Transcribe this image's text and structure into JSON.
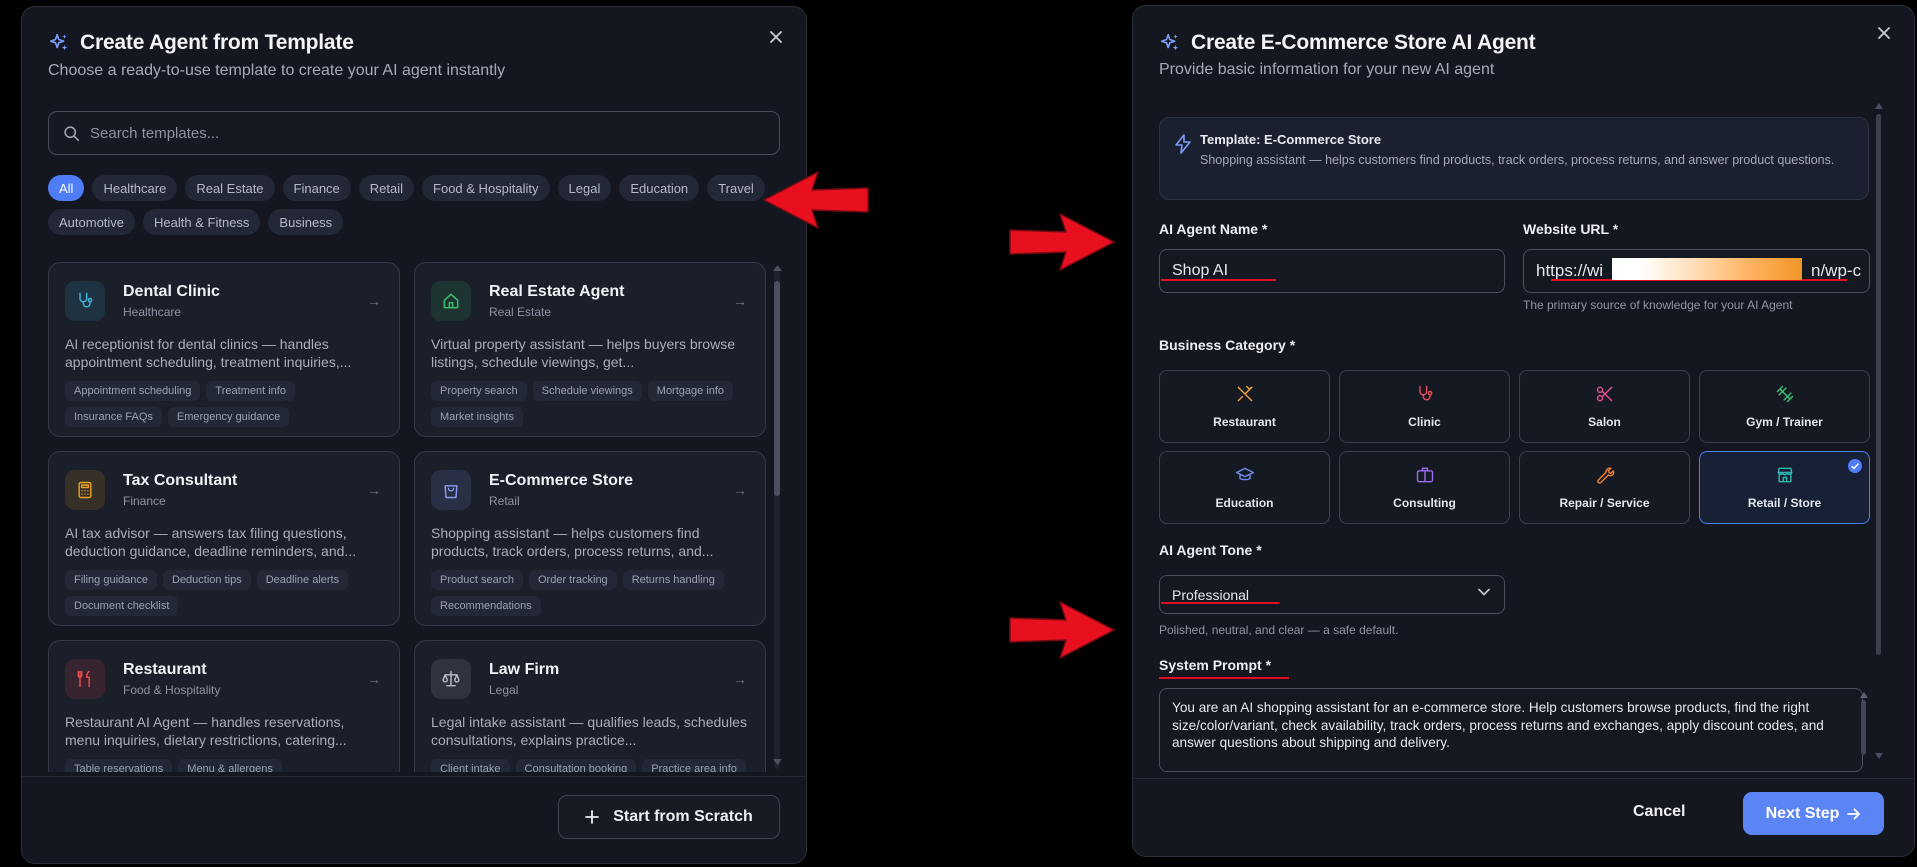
{
  "left_panel": {
    "title": "Create Agent from Template",
    "subtitle": "Choose a ready-to-use template to create your AI agent instantly",
    "search_placeholder": "Search templates...",
    "filters": [
      "All",
      "Healthcare",
      "Real Estate",
      "Finance",
      "Retail",
      "Food & Hospitality",
      "Legal",
      "Education",
      "Travel",
      "Automotive",
      "Health & Fitness",
      "Business"
    ],
    "active_filter": "All",
    "cards": [
      {
        "title": "Dental Clinic",
        "category": "Healthcare",
        "description": "AI receptionist for dental clinics — handles appointment scheduling, treatment inquiries,...",
        "tags": [
          "Appointment scheduling",
          "Treatment info",
          "Insurance FAQs",
          "Emergency guidance"
        ],
        "icon": "stethoscope-icon",
        "color": "#3fb6d9"
      },
      {
        "title": "Real Estate Agent",
        "category": "Real Estate",
        "description": "Virtual property assistant — helps buyers browse listings, schedule viewings, get...",
        "tags": [
          "Property search",
          "Schedule viewings",
          "Mortgage info",
          "Market insights"
        ],
        "icon": "house-icon",
        "color": "#37c26b"
      },
      {
        "title": "Tax Consultant",
        "category": "Finance",
        "description": "AI tax advisor — answers tax filing questions, deduction guidance, deadline reminders, and...",
        "tags": [
          "Filing guidance",
          "Deduction tips",
          "Deadline alerts",
          "Document checklist"
        ],
        "icon": "calculator-icon",
        "color": "#f0a321"
      },
      {
        "title": "E-Commerce Store",
        "category": "Retail",
        "description": "Shopping assistant — helps customers find products, track orders, process returns, and...",
        "tags": [
          "Product search",
          "Order tracking",
          "Returns handling",
          "Recommendations"
        ],
        "icon": "shopping-bag-icon",
        "color": "#8a9cf6"
      },
      {
        "title": "Restaurant",
        "category": "Food & Hospitality",
        "description": "Restaurant AI Agent — handles reservations, menu inquiries, dietary restrictions, catering...",
        "tags": [
          "Table reservations",
          "Menu & allergens"
        ],
        "icon": "fork-knife-icon",
        "color": "#ef4b4b"
      },
      {
        "title": "Law Firm",
        "category": "Legal",
        "description": "Legal intake assistant — qualifies leads, schedules consultations, explains practice...",
        "tags": [
          "Client intake",
          "Consultation booking",
          "Practice area info"
        ],
        "icon": "scale-icon",
        "color": "#b7bcc8"
      }
    ],
    "scratch_button": "Start from Scratch"
  },
  "right_panel": {
    "title": "Create E-Commerce Store AI Agent",
    "subtitle": "Provide basic information for your new AI agent",
    "template_label": "Template: E-Commerce Store",
    "template_desc": "Shopping assistant — helps customers find products, track orders, process returns, and answer product questions.",
    "name_label": "AI Agent Name *",
    "name_value": "Shop AI",
    "url_label": "Website URL *",
    "url_value_start": "https://wi",
    "url_value_end": "n/wp-c",
    "url_hint": "The primary source of knowledge for your AI Agent",
    "category_label": "Business Category *",
    "categories": [
      {
        "label": "Restaurant",
        "icon": "utensils-icon",
        "color": "#f2a23a"
      },
      {
        "label": "Clinic",
        "icon": "stethoscope-icon",
        "color": "#ef4b5a"
      },
      {
        "label": "Salon",
        "icon": "scissors-icon",
        "color": "#e2508f"
      },
      {
        "label": "Gym / Trainer",
        "icon": "dumbbell-icon",
        "color": "#38c172"
      },
      {
        "label": "Education",
        "icon": "graduation-cap-icon",
        "color": "#6f8cf5"
      },
      {
        "label": "Consulting",
        "icon": "briefcase-icon",
        "color": "#9b6bf0"
      },
      {
        "label": "Repair / Service",
        "icon": "wrench-icon",
        "color": "#f2822c"
      },
      {
        "label": "Retail / Store",
        "icon": "store-icon",
        "color": "#2fb6b0"
      }
    ],
    "selected_category": "Retail / Store",
    "tone_label": "AI Agent Tone *",
    "tone_value": "Professional",
    "tone_hint": "Polished, neutral, and clear — a safe default.",
    "prompt_label": "System Prompt *",
    "prompt_value": "You are an AI shopping assistant for an e-commerce store. Help customers browse products, find the right size/color/variant, check availability, track orders, process returns and exchanges, apply discount codes, and answer questions about shipping and delivery.",
    "cancel_button": "Cancel",
    "next_button": "Next Step"
  },
  "colors": {
    "accent": "#4f7cf7",
    "annotation_red": "#e10f22",
    "panel_bg": "#14171f"
  }
}
